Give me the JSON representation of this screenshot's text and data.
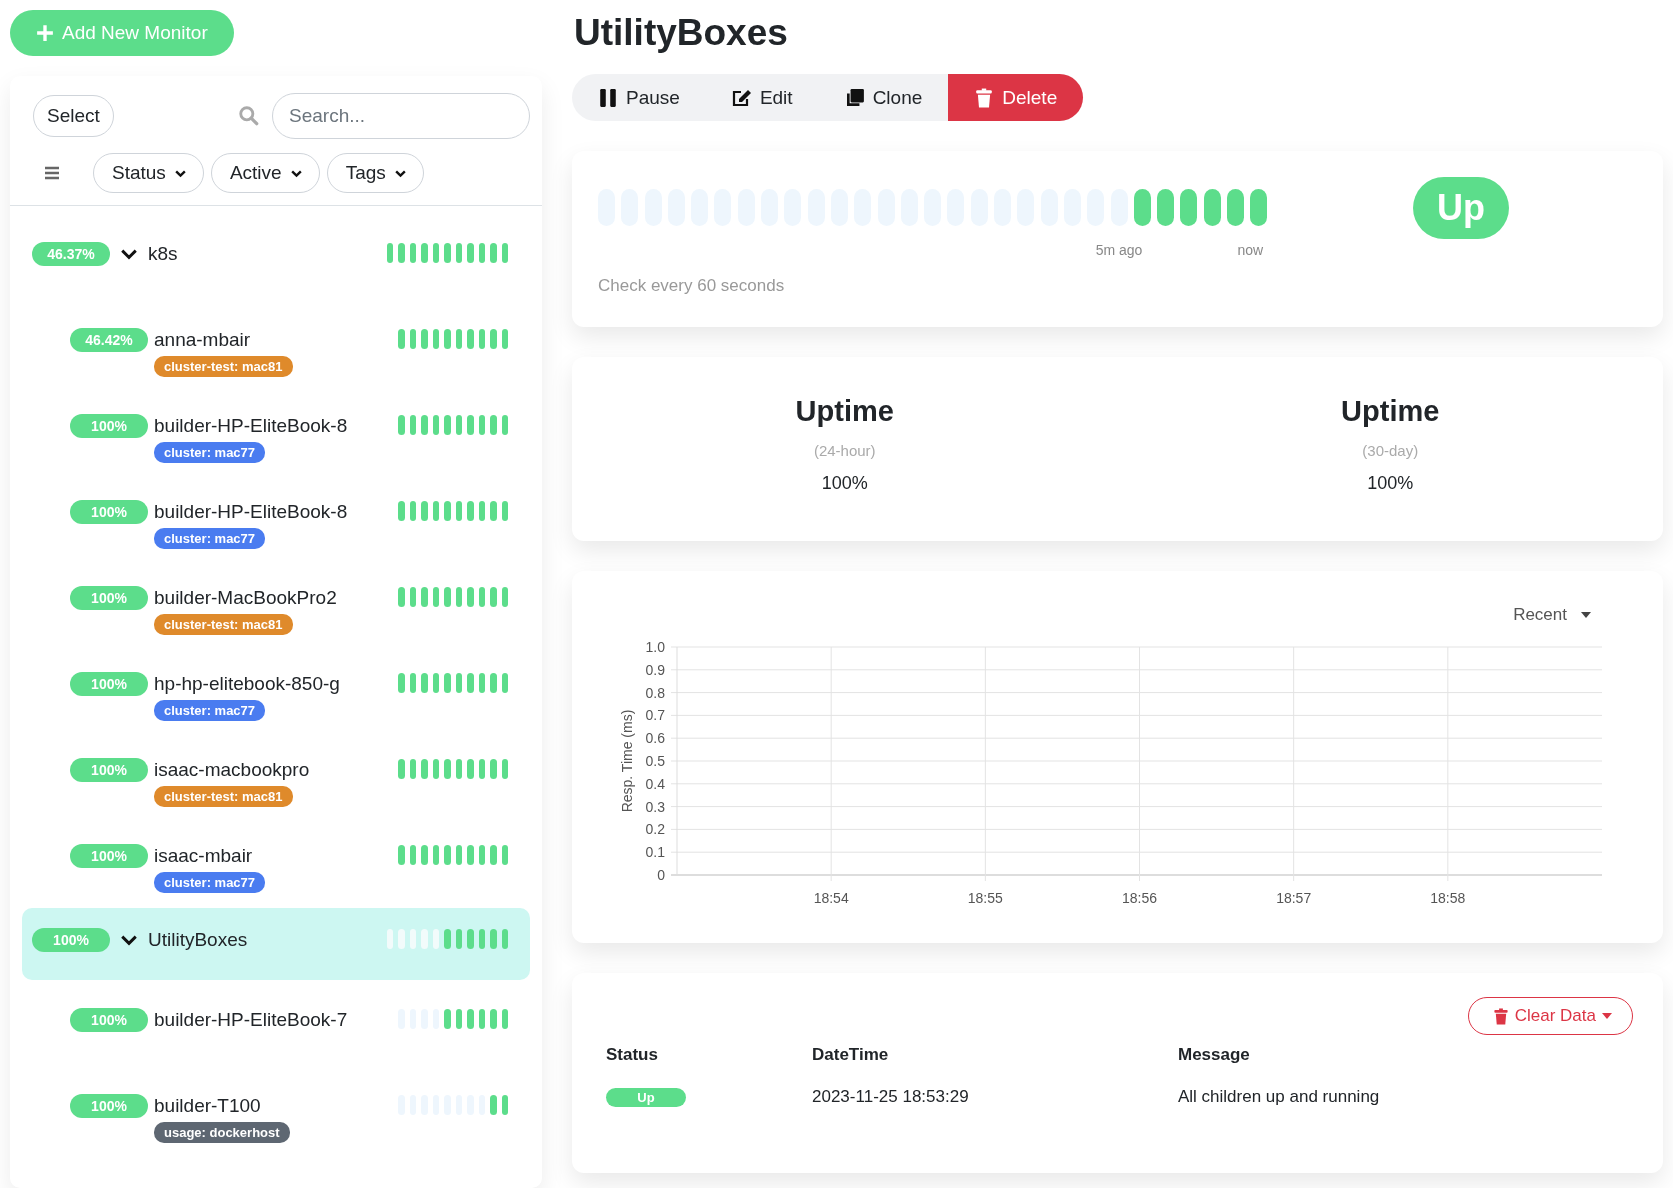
{
  "add_button": {
    "label": "Add New Monitor"
  },
  "list_toolbar": {
    "select_button": "Select",
    "search": {
      "placeholder": "Search..."
    },
    "filters": [
      "Status",
      "Active",
      "Tags"
    ]
  },
  "monitors": [
    {
      "uptime": "46.37%",
      "name": "k8s",
      "expanded": true,
      "selected": false,
      "beats": [
        {
          "up": true
        },
        {
          "up": true
        },
        {
          "up": true
        },
        {
          "up": true
        },
        {
          "up": true
        },
        {
          "up": true
        },
        {
          "up": true
        },
        {
          "up": true
        },
        {
          "up": true
        },
        {
          "up": true
        },
        {
          "up": true
        }
      ],
      "children": [
        {
          "uptime": "46.42%",
          "name": "anna-mbair",
          "tags": [
            {
              "label": "cluster-test: mac81",
              "color": "#df8a2b"
            }
          ],
          "beats": [
            {
              "up": true
            },
            {
              "up": true
            },
            {
              "up": true
            },
            {
              "up": true
            },
            {
              "up": true
            },
            {
              "up": true
            },
            {
              "up": true
            },
            {
              "up": true
            },
            {
              "up": true
            },
            {
              "up": true
            }
          ]
        },
        {
          "uptime": "100%",
          "name": "builder-HP-EliteBook-8",
          "tags": [
            {
              "label": "cluster: mac77",
              "color": "#4a7cf0"
            }
          ],
          "beats": [
            {
              "up": true
            },
            {
              "up": true
            },
            {
              "up": true
            },
            {
              "up": true
            },
            {
              "up": true
            },
            {
              "up": true
            },
            {
              "up": true
            },
            {
              "up": true
            },
            {
              "up": true
            },
            {
              "up": true
            }
          ]
        },
        {
          "uptime": "100%",
          "name": "builder-HP-EliteBook-8",
          "tags": [
            {
              "label": "cluster: mac77",
              "color": "#4a7cf0"
            }
          ],
          "beats": [
            {
              "up": true
            },
            {
              "up": true
            },
            {
              "up": true
            },
            {
              "up": true
            },
            {
              "up": true
            },
            {
              "up": true
            },
            {
              "up": true
            },
            {
              "up": true
            },
            {
              "up": true
            },
            {
              "up": true
            }
          ]
        },
        {
          "uptime": "100%",
          "name": "builder-MacBookPro2",
          "tags": [
            {
              "label": "cluster-test: mac81",
              "color": "#df8a2b"
            }
          ],
          "beats": [
            {
              "up": true
            },
            {
              "up": true
            },
            {
              "up": true
            },
            {
              "up": true
            },
            {
              "up": true
            },
            {
              "up": true
            },
            {
              "up": true
            },
            {
              "up": true
            },
            {
              "up": true
            },
            {
              "up": true
            }
          ]
        },
        {
          "uptime": "100%",
          "name": "hp-hp-elitebook-850-g",
          "tags": [
            {
              "label": "cluster: mac77",
              "color": "#4a7cf0"
            }
          ],
          "beats": [
            {
              "up": true
            },
            {
              "up": true
            },
            {
              "up": true
            },
            {
              "up": true
            },
            {
              "up": true
            },
            {
              "up": true
            },
            {
              "up": true
            },
            {
              "up": true
            },
            {
              "up": true
            },
            {
              "up": true
            }
          ]
        },
        {
          "uptime": "100%",
          "name": "isaac-macbookpro",
          "tags": [
            {
              "label": "cluster-test: mac81",
              "color": "#df8a2b"
            }
          ],
          "beats": [
            {
              "up": true
            },
            {
              "up": true
            },
            {
              "up": true
            },
            {
              "up": true
            },
            {
              "up": true
            },
            {
              "up": true
            },
            {
              "up": true
            },
            {
              "up": true
            },
            {
              "up": true
            },
            {
              "up": true
            }
          ]
        },
        {
          "uptime": "100%",
          "name": "isaac-mbair",
          "tags": [
            {
              "label": "cluster: mac77",
              "color": "#4a7cf0"
            }
          ],
          "beats": [
            {
              "up": true
            },
            {
              "up": true
            },
            {
              "up": true
            },
            {
              "up": true
            },
            {
              "up": true
            },
            {
              "up": true
            },
            {
              "up": true
            },
            {
              "up": true
            },
            {
              "up": true
            },
            {
              "up": true
            }
          ]
        }
      ]
    },
    {
      "uptime": "100%",
      "name": "UtilityBoxes",
      "expanded": true,
      "selected": true,
      "beats": [
        {
          "up": false
        },
        {
          "up": false
        },
        {
          "up": false
        },
        {
          "up": false
        },
        {
          "up": false
        },
        {
          "up": true
        },
        {
          "up": true
        },
        {
          "up": true
        },
        {
          "up": true
        },
        {
          "up": true
        },
        {
          "up": true
        }
      ],
      "children": [
        {
          "uptime": "100%",
          "name": "builder-HP-EliteBook-7",
          "beats": [
            {
              "up": false
            },
            {
              "up": false
            },
            {
              "up": false
            },
            {
              "up": false
            },
            {
              "up": true
            },
            {
              "up": true
            },
            {
              "up": true
            },
            {
              "up": true
            },
            {
              "up": true
            },
            {
              "up": true
            }
          ]
        },
        {
          "uptime": "100%",
          "name": "builder-T100",
          "tags": [
            {
              "label": "usage: dockerhost",
              "color": "#5e6772"
            }
          ],
          "beats": [
            {
              "up": false
            },
            {
              "up": false
            },
            {
              "up": false
            },
            {
              "up": false
            },
            {
              "up": false
            },
            {
              "up": false
            },
            {
              "up": false
            },
            {
              "up": false
            },
            {
              "up": true
            },
            {
              "up": true
            }
          ]
        }
      ]
    }
  ],
  "detail": {
    "title": "UtilityBoxes",
    "actions": [
      {
        "label": "Pause",
        "kind": "pause"
      },
      {
        "label": "Edit",
        "kind": "edit"
      },
      {
        "label": "Clone",
        "kind": "clone"
      },
      {
        "label": "Delete",
        "kind": "delete"
      }
    ],
    "heartbeat": {
      "beats": [
        {
          "up": false
        },
        {
          "up": false
        },
        {
          "up": false
        },
        {
          "up": false
        },
        {
          "up": false
        },
        {
          "up": false
        },
        {
          "up": false
        },
        {
          "up": false
        },
        {
          "up": false
        },
        {
          "up": false
        },
        {
          "up": false
        },
        {
          "up": false
        },
        {
          "up": false
        },
        {
          "up": false
        },
        {
          "up": false
        },
        {
          "up": false
        },
        {
          "up": false
        },
        {
          "up": false
        },
        {
          "up": false
        },
        {
          "up": false
        },
        {
          "up": false
        },
        {
          "up": false
        },
        {
          "up": false
        },
        {
          "up": true
        },
        {
          "up": true
        },
        {
          "up": true
        },
        {
          "up": true
        },
        {
          "up": true
        },
        {
          "up": true
        }
      ],
      "start_label": "5m ago",
      "end_label": "now",
      "interval": "Check every 60 seconds",
      "status": "Up"
    },
    "uptime": [
      {
        "title": "Uptime",
        "period": "(24-hour)",
        "value": "100%"
      },
      {
        "title": "Uptime",
        "period": "(30-day)",
        "value": "100%"
      }
    ],
    "response_chart": {
      "period_select": "Recent",
      "chart_data": {
        "type": "line",
        "ylabel": "Resp. Time (ms)",
        "ylim": [
          0,
          1
        ],
        "grid": true,
        "categories": [
          null,
          "18:54",
          "18:55",
          "18:56",
          "18:57",
          "18:58",
          null
        ],
        "yticks": [
          0,
          0.1,
          0.2,
          0.3,
          0.4,
          0.5,
          0.6,
          0.7,
          0.8,
          0.9,
          {
            "value": 1,
            "label": "1.0"
          }
        ]
      }
    },
    "events": {
      "clear_button": "Clear Data",
      "columns": [
        "Status",
        "DateTime",
        "Message"
      ],
      "rows": [
        {
          "status": "Up",
          "datetime": "2023-11-25 18:53:29",
          "message": "All children up and running"
        }
      ]
    }
  }
}
